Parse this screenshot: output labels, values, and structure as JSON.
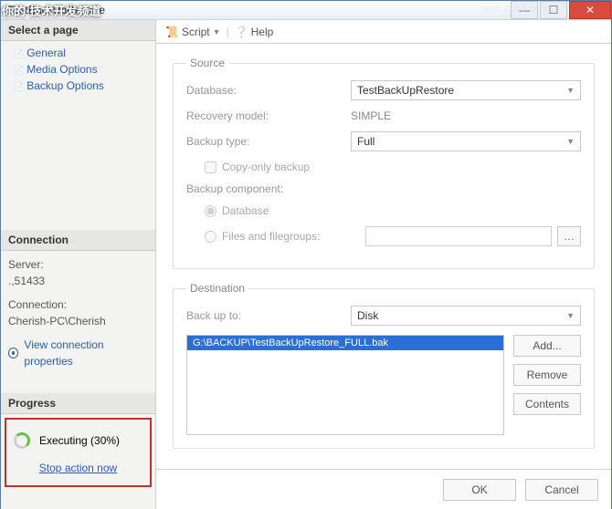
{
  "window": {
    "title": "TestBackUpRestore"
  },
  "watermark": {
    "left": "你的·技术开发频道",
    "right": "tech.it168.com"
  },
  "toolbar": {
    "script": "Script",
    "help": "Help"
  },
  "left": {
    "select_page": "Select a page",
    "pages": [
      "General",
      "Media Options",
      "Backup Options"
    ],
    "connection": {
      "header": "Connection",
      "server_label": "Server:",
      "server_value": ".,51433",
      "conn_label": "Connection:",
      "conn_value": "Cherish-PC\\Cherish",
      "view_props": "View connection properties"
    },
    "progress": {
      "header": "Progress",
      "status": "Executing (30%)",
      "stop": "Stop action now"
    }
  },
  "source": {
    "legend": "Source",
    "database_label": "Database:",
    "database_value": "TestBackUpRestore",
    "recovery_label": "Recovery model:",
    "recovery_value": "SIMPLE",
    "backup_type_label": "Backup type:",
    "backup_type_value": "Full",
    "copy_only": "Copy-only backup",
    "component_label": "Backup component:",
    "component_db": "Database",
    "component_files": "Files and filegroups:"
  },
  "destination": {
    "legend": "Destination",
    "backup_to_label": "Back up to:",
    "backup_to_value": "Disk",
    "list_item": "G:\\BACKUP\\TestBackUpRestore_FULL.bak",
    "add": "Add...",
    "remove": "Remove",
    "contents": "Contents"
  },
  "footer": {
    "ok": "OK",
    "cancel": "Cancel"
  }
}
